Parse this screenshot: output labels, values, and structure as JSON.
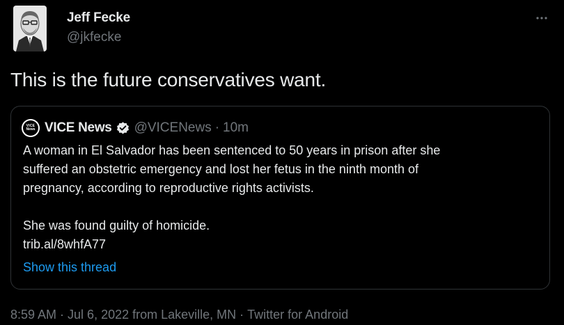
{
  "author": {
    "name": "Jeff Fecke",
    "handle": "@jkfecke"
  },
  "tweet": {
    "text": "This is the future conservatives want."
  },
  "quoted_tweet": {
    "logo_text_top": "VICE",
    "logo_text_bottom": "News",
    "name": "VICE News",
    "handle": "@VICENews",
    "separator": "·",
    "time": "10m",
    "body_lines": [
      "A woman in El Salvador has been sentenced to 50 years in prison after she",
      "suffered an obstetric emergency and lost her fetus in the ninth month of",
      "pregnancy, according to reproductive rights activists."
    ],
    "body_line_2": "She was found guilty of homicide.",
    "link": "trib.al/8whfA77",
    "show_thread": "Show this thread"
  },
  "meta": {
    "time": "8:59 AM",
    "sep1": "·",
    "date_location": "Jul 6, 2022 from Lakeville, MN",
    "sep2": "·",
    "source": "Twitter for Android"
  },
  "colors": {
    "background": "#000000",
    "text": "#e7e9ea",
    "muted": "#71767b",
    "link": "#1d9bf0",
    "border": "#2f3336"
  },
  "icons": {
    "more": "more-horizontal-icon",
    "verified": "verified-badge-icon"
  }
}
